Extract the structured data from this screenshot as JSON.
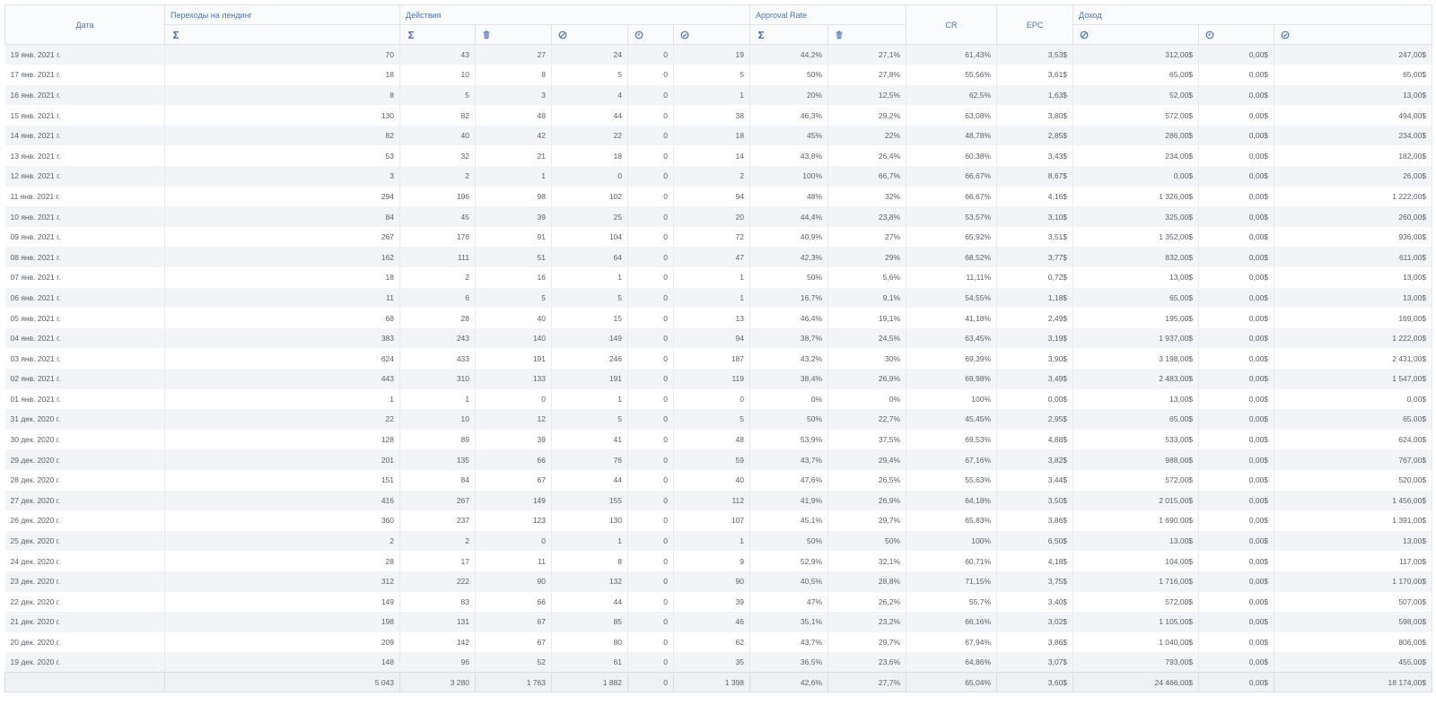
{
  "header": {
    "date": "Дата",
    "landing": "Переходы на лендинг",
    "actions": "Действия",
    "approval": "Approval Rate",
    "cr": "CR",
    "epc": "EPC",
    "income": "Доход",
    "sum_symbol": "Σ"
  },
  "icons": {
    "actions": [
      "sum-icon",
      "trash-icon",
      "cancel-icon",
      "clock-icon",
      "check-circle-icon"
    ],
    "approval": [
      "sum-icon",
      "trash-icon"
    ],
    "income": [
      "cancel-icon",
      "clock-icon",
      "check-circle-icon"
    ],
    "accent_color": "#4a72c4"
  },
  "rows": [
    [
      "19 янв. 2021 г.",
      "70",
      "43",
      "27",
      "24",
      "0",
      "19",
      "44,2%",
      "27,1%",
      "61,43%",
      "3,53$",
      "312,00$",
      "0,00$",
      "247,00$"
    ],
    [
      "17 янв. 2021 г.",
      "18",
      "10",
      "8",
      "5",
      "0",
      "5",
      "50%",
      "27,8%",
      "55,56%",
      "3,61$",
      "65,00$",
      "0,00$",
      "65,00$"
    ],
    [
      "16 янв. 2021 г.",
      "8",
      "5",
      "3",
      "4",
      "0",
      "1",
      "20%",
      "12,5%",
      "62,5%",
      "1,63$",
      "52,00$",
      "0,00$",
      "13,00$"
    ],
    [
      "15 янв. 2021 г.",
      "130",
      "82",
      "48",
      "44",
      "0",
      "38",
      "46,3%",
      "29,2%",
      "63,08%",
      "3,80$",
      "572,00$",
      "0,00$",
      "494,00$"
    ],
    [
      "14 янв. 2021 г.",
      "82",
      "40",
      "42",
      "22",
      "0",
      "18",
      "45%",
      "22%",
      "48,78%",
      "2,85$",
      "286,00$",
      "0,00$",
      "234,00$"
    ],
    [
      "13 янв. 2021 г.",
      "53",
      "32",
      "21",
      "18",
      "0",
      "14",
      "43,8%",
      "26,4%",
      "60,38%",
      "3,43$",
      "234,00$",
      "0,00$",
      "182,00$"
    ],
    [
      "12 янв. 2021 г.",
      "3",
      "2",
      "1",
      "0",
      "0",
      "2",
      "100%",
      "66,7%",
      "66,67%",
      "8,67$",
      "0,00$",
      "0,00$",
      "26,00$"
    ],
    [
      "11 янв. 2021 г.",
      "294",
      "196",
      "98",
      "102",
      "0",
      "94",
      "48%",
      "32%",
      "66,67%",
      "4,16$",
      "1 326,00$",
      "0,00$",
      "1 222,00$"
    ],
    [
      "10 янв. 2021 г.",
      "84",
      "45",
      "39",
      "25",
      "0",
      "20",
      "44,4%",
      "23,8%",
      "53,57%",
      "3,10$",
      "325,00$",
      "0,00$",
      "260,00$"
    ],
    [
      "09 янв. 2021 г.",
      "267",
      "176",
      "91",
      "104",
      "0",
      "72",
      "40,9%",
      "27%",
      "65,92%",
      "3,51$",
      "1 352,00$",
      "0,00$",
      "936,00$"
    ],
    [
      "08 янв. 2021 г.",
      "162",
      "111",
      "51",
      "64",
      "0",
      "47",
      "42,3%",
      "29%",
      "68,52%",
      "3,77$",
      "832,00$",
      "0,00$",
      "611,00$"
    ],
    [
      "07 янв. 2021 г.",
      "18",
      "2",
      "16",
      "1",
      "0",
      "1",
      "50%",
      "5,6%",
      "11,11%",
      "0,72$",
      "13,00$",
      "0,00$",
      "13,00$"
    ],
    [
      "06 янв. 2021 г.",
      "11",
      "6",
      "5",
      "5",
      "0",
      "1",
      "16,7%",
      "9,1%",
      "54,55%",
      "1,18$",
      "65,00$",
      "0,00$",
      "13,00$"
    ],
    [
      "05 янв. 2021 г.",
      "68",
      "28",
      "40",
      "15",
      "0",
      "13",
      "46,4%",
      "19,1%",
      "41,18%",
      "2,49$",
      "195,00$",
      "0,00$",
      "169,00$"
    ],
    [
      "04 янв. 2021 г.",
      "383",
      "243",
      "140",
      "149",
      "0",
      "94",
      "38,7%",
      "24,5%",
      "63,45%",
      "3,19$",
      "1 937,00$",
      "0,00$",
      "1 222,00$"
    ],
    [
      "03 янв. 2021 г.",
      "624",
      "433",
      "191",
      "246",
      "0",
      "187",
      "43,2%",
      "30%",
      "69,39%",
      "3,90$",
      "3 198,00$",
      "0,00$",
      "2 431,00$"
    ],
    [
      "02 янв. 2021 г.",
      "443",
      "310",
      "133",
      "191",
      "0",
      "119",
      "38,4%",
      "26,9%",
      "69,98%",
      "3,49$",
      "2 483,00$",
      "0,00$",
      "1 547,00$"
    ],
    [
      "01 янв. 2021 г.",
      "1",
      "1",
      "0",
      "1",
      "0",
      "0",
      "0%",
      "0%",
      "100%",
      "0,00$",
      "13,00$",
      "0,00$",
      "0,00$"
    ],
    [
      "31 дек. 2020 г.",
      "22",
      "10",
      "12",
      "5",
      "0",
      "5",
      "50%",
      "22,7%",
      "45,45%",
      "2,95$",
      "65,00$",
      "0,00$",
      "65,00$"
    ],
    [
      "30 дек. 2020 г.",
      "128",
      "89",
      "39",
      "41",
      "0",
      "48",
      "53,9%",
      "37,5%",
      "69,53%",
      "4,88$",
      "533,00$",
      "0,00$",
      "624,00$"
    ],
    [
      "29 дек. 2020 г.",
      "201",
      "135",
      "66",
      "76",
      "0",
      "59",
      "43,7%",
      "29,4%",
      "67,16%",
      "3,82$",
      "988,00$",
      "0,00$",
      "767,00$"
    ],
    [
      "28 дек. 2020 г.",
      "151",
      "84",
      "67",
      "44",
      "0",
      "40",
      "47,6%",
      "26,5%",
      "55,63%",
      "3,44$",
      "572,00$",
      "0,00$",
      "520,00$"
    ],
    [
      "27 дек. 2020 г.",
      "416",
      "267",
      "149",
      "155",
      "0",
      "112",
      "41,9%",
      "26,9%",
      "64,18%",
      "3,50$",
      "2 015,00$",
      "0,00$",
      "1 456,00$"
    ],
    [
      "26 дек. 2020 г.",
      "360",
      "237",
      "123",
      "130",
      "0",
      "107",
      "45,1%",
      "29,7%",
      "65,83%",
      "3,86$",
      "1 690,00$",
      "0,00$",
      "1 391,00$"
    ],
    [
      "25 дек. 2020 г.",
      "2",
      "2",
      "0",
      "1",
      "0",
      "1",
      "50%",
      "50%",
      "100%",
      "6,50$",
      "13,00$",
      "0,00$",
      "13,00$"
    ],
    [
      "24 дек. 2020 г.",
      "28",
      "17",
      "11",
      "8",
      "0",
      "9",
      "52,9%",
      "32,1%",
      "60,71%",
      "4,18$",
      "104,00$",
      "0,00$",
      "117,00$"
    ],
    [
      "23 дек. 2020 г.",
      "312",
      "222",
      "90",
      "132",
      "0",
      "90",
      "40,5%",
      "28,8%",
      "71,15%",
      "3,75$",
      "1 716,00$",
      "0,00$",
      "1 170,00$"
    ],
    [
      "22 дек. 2020 г.",
      "149",
      "83",
      "66",
      "44",
      "0",
      "39",
      "47%",
      "26,2%",
      "55,7%",
      "3,40$",
      "572,00$",
      "0,00$",
      "507,00$"
    ],
    [
      "21 дек. 2020 г.",
      "198",
      "131",
      "67",
      "85",
      "0",
      "46",
      "35,1%",
      "23,2%",
      "66,16%",
      "3,02$",
      "1 105,00$",
      "0,00$",
      "598,00$"
    ],
    [
      "20 дек. 2020 г.",
      "209",
      "142",
      "67",
      "80",
      "0",
      "62",
      "43,7%",
      "29,7%",
      "67,94%",
      "3,86$",
      "1 040,00$",
      "0,00$",
      "806,00$"
    ],
    [
      "19 дек. 2020 г.",
      "148",
      "96",
      "52",
      "61",
      "0",
      "35",
      "36,5%",
      "23,6%",
      "64,86%",
      "3,07$",
      "793,00$",
      "0,00$",
      "455,00$"
    ]
  ],
  "totals": [
    "",
    "5 043",
    "3 280",
    "1 763",
    "1 882",
    "0",
    "1 398",
    "42,6%",
    "27,7%",
    "65,04%",
    "3,60$",
    "24 466,00$",
    "0,00$",
    "18 174,00$"
  ]
}
